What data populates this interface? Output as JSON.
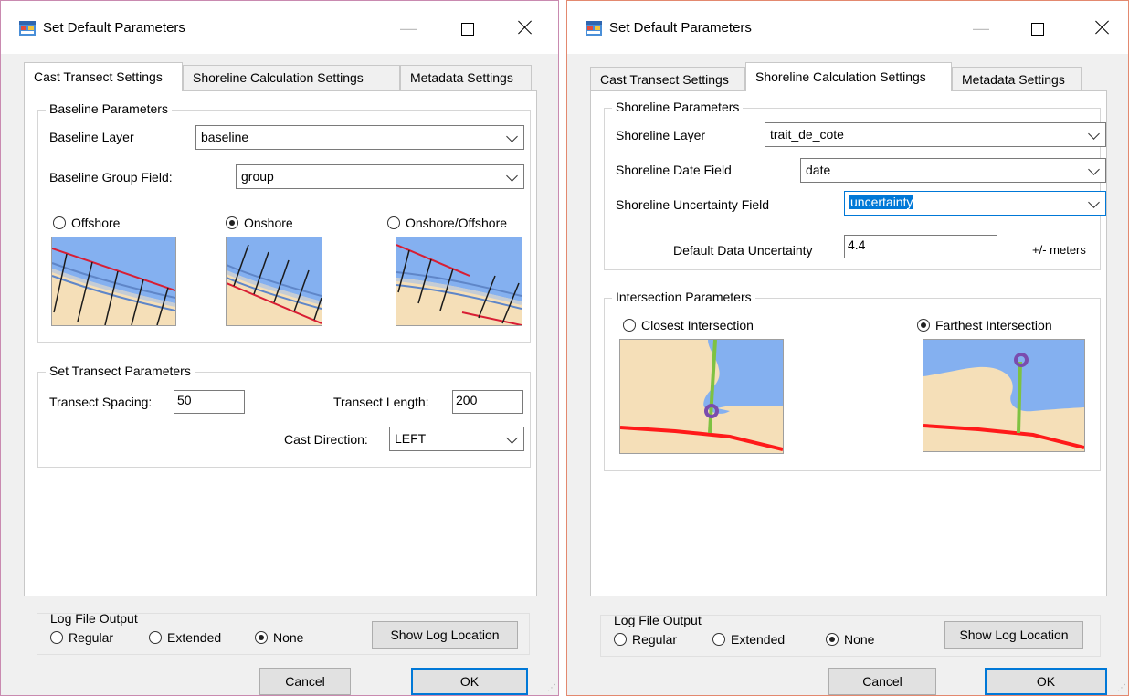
{
  "left": {
    "title": "Set Default Parameters",
    "tabs": {
      "cast": "Cast Transect Settings",
      "shoreline": "Shoreline Calculation Settings",
      "metadata": "Metadata Settings"
    },
    "baseline_group": "Baseline Parameters",
    "baseline_layer_label": "Baseline Layer",
    "baseline_layer_value": "baseline",
    "baseline_group_field_label": "Baseline Group Field:",
    "baseline_group_field_value": "group",
    "radio_offshore": "Offshore",
    "radio_onshore": "Onshore",
    "radio_onshore_offshore": "Onshore/Offshore",
    "transect_group": "Set Transect Parameters",
    "spacing_label": "Transect Spacing:",
    "spacing_value": "50",
    "length_label": "Transect Length:",
    "length_value": "200",
    "cast_dir_label": "Cast Direction:",
    "cast_dir_value": "LEFT",
    "log_title": "Log File Output",
    "log_regular": "Regular",
    "log_extended": "Extended",
    "log_none": "None",
    "show_log": "Show Log Location",
    "cancel": "Cancel",
    "ok": "OK"
  },
  "right": {
    "title": "Set Default Parameters",
    "tabs": {
      "cast": "Cast Transect Settings",
      "shoreline": "Shoreline Calculation Settings",
      "metadata": "Metadata Settings"
    },
    "shoreline_group": "Shoreline Parameters",
    "shoreline_layer_label": "Shoreline Layer",
    "shoreline_layer_value": "trait_de_cote",
    "date_field_label": "Shoreline Date Field",
    "date_field_value": "date",
    "uncert_field_label": "Shoreline Uncertainty Field",
    "uncert_field_value": "uncertainty",
    "default_uncert_label": "Default Data Uncertainty",
    "default_uncert_value": "4.4",
    "units": "+/- meters",
    "intersection_group": "Intersection Parameters",
    "radio_closest": "Closest Intersection",
    "radio_farthest": "Farthest Intersection",
    "log_title": "Log File Output",
    "log_regular": "Regular",
    "log_extended": "Extended",
    "log_none": "None",
    "show_log": "Show Log Location",
    "cancel": "Cancel",
    "ok": "OK"
  },
  "colors": {
    "sea": "#84b0f0",
    "sand": "#f5dfb8",
    "baseline": "#d81e34",
    "shoreline_band": "#5f86c8",
    "transect": "#1a1a1a",
    "accent": "#0078d7",
    "intersect_line": "#7ec242",
    "intersect_point": "#7a4cae",
    "shoreline_red": "#ff1a1a"
  },
  "selected": {
    "left_baseline_position": "Onshore",
    "left_log": "None",
    "right_intersection": "Farthest Intersection",
    "right_log": "None",
    "left_active_tab": "Cast Transect Settings",
    "right_active_tab": "Shoreline Calculation Settings"
  }
}
